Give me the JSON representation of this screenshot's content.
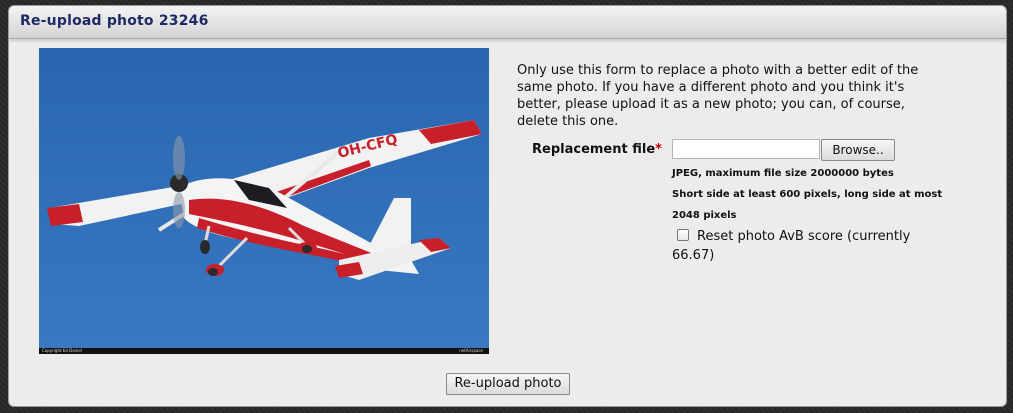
{
  "header": {
    "title": "Re-upload photo 23246"
  },
  "photo": {
    "credit_left": "Copyright Ed Daniel",
    "credit_right": "netAirspace",
    "registration": "OH-CFQ"
  },
  "form": {
    "info_text": "Only use this form to replace a photo with a better edit of the same photo. If you have a different photo and you think it's better, please upload it as a new photo; you can, of course, delete this one.",
    "file_label": "Replacement file",
    "required_mark": "*",
    "browse_label": "Browse..",
    "hint_size": "JPEG, maximum file size 2000000 bytes",
    "hint_pixels": "Short side at least 600 pixels, long side at most 2048 pixels",
    "reset_label": "Reset photo AvB score (currently 66.67)",
    "reset_checked": false,
    "submit_label": "Re-upload photo"
  },
  "colors": {
    "title": "#1d2a66",
    "sky": "#2f6db6",
    "aircraft_red": "#c81f2a",
    "required": "#cc0000"
  }
}
